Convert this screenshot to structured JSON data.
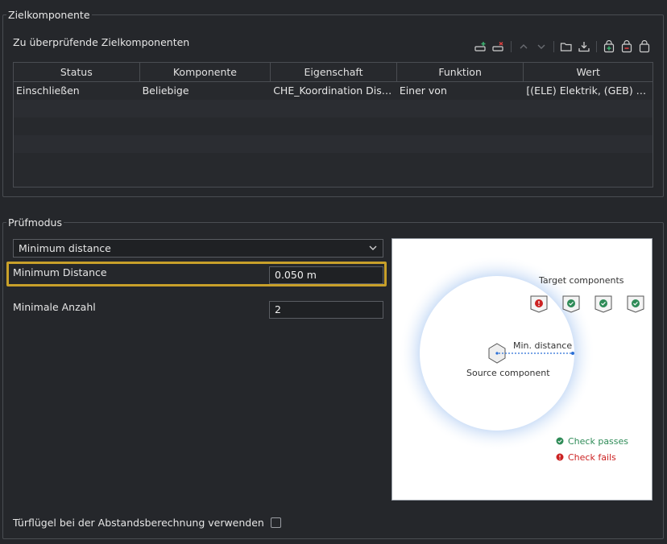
{
  "zielkomponente": {
    "group_title": "Zielkomponente",
    "subtitle": "Zu überprüfende Zielkomponenten",
    "columns": [
      "Status",
      "Komponente",
      "Eigenschaft",
      "Funktion",
      "Wert"
    ],
    "rows": [
      [
        "Einschließen",
        "Beliebige",
        "CHE_Koordination Diszip…",
        "Einer von",
        "[(ELE) Elektrik, (GEB) Ge…"
      ]
    ],
    "toolbar_icons": [
      "add-row-icon",
      "remove-row-icon",
      "move-up-icon",
      "move-down-icon",
      "open-folder-icon",
      "import-icon",
      "add-set-icon",
      "remove-set-icon",
      "set-icon"
    ]
  },
  "pruefmodus": {
    "group_title": "Prüfmodus",
    "mode_select": "Minimum distance",
    "min_distance_label": "Minimum Distance",
    "min_distance_value": "0.050 m",
    "min_count_label": "Minimale Anzahl",
    "min_count_value": "2",
    "door_leaf_label": "Türflügel bei der Abstandsberechnung verwenden",
    "door_leaf_checked": false
  },
  "diagram": {
    "target_label": "Target components",
    "distance_label": "Min. distance",
    "source_label": "Source component",
    "legend_pass": "Check passes",
    "legend_fail": "Check fails",
    "targets": [
      "fail",
      "pass",
      "pass",
      "pass"
    ],
    "colors": {
      "pass": "#2e8b57",
      "fail": "#cc2222",
      "halo": "#cfe0f7",
      "accent": "#c8a02a"
    }
  }
}
